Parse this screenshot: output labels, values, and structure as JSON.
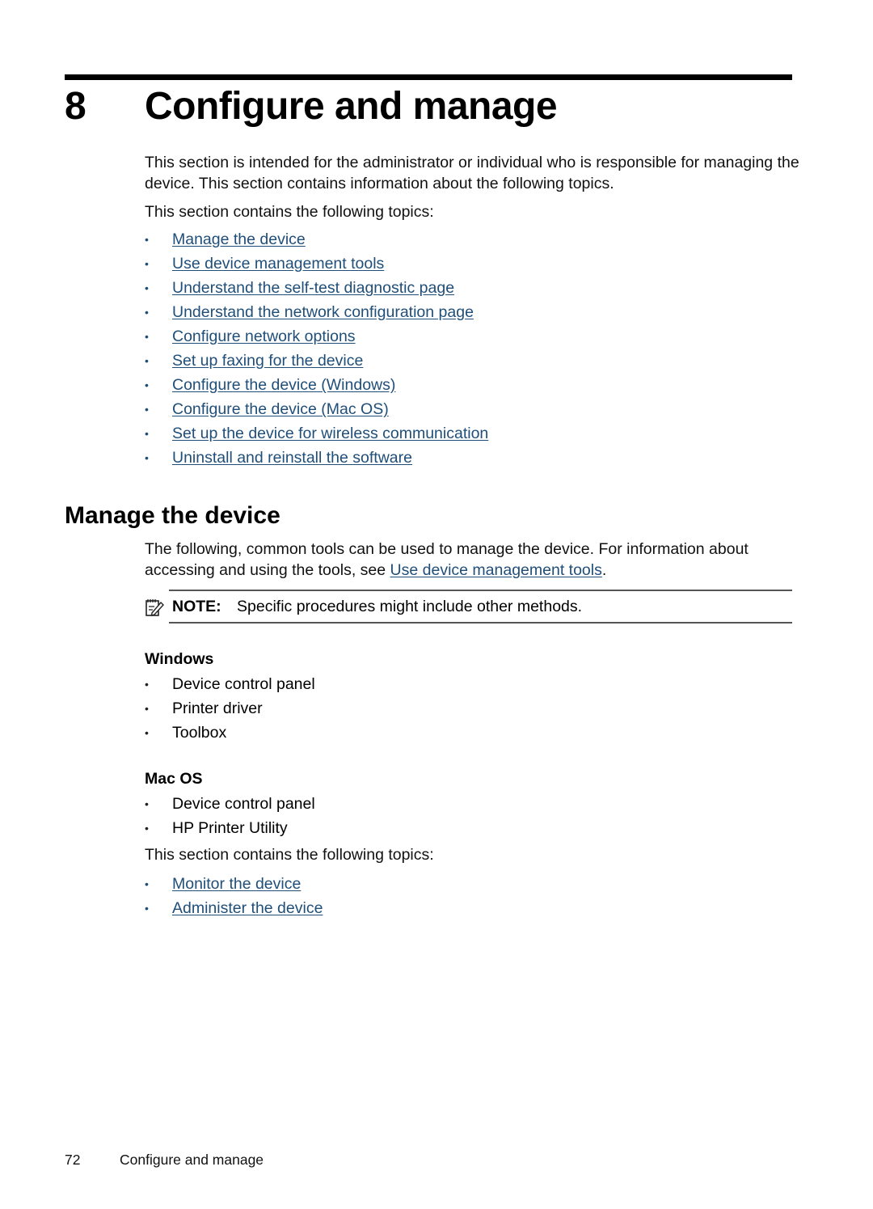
{
  "chapter": {
    "number": "8",
    "title": "Configure and manage"
  },
  "intro": {
    "paragraph": "This section is intended for the administrator or individual who is responsible for managing the device. This section contains information about the following topics.",
    "topics_lead": "This section contains the following topics:",
    "topics": [
      {
        "label": "Manage the device"
      },
      {
        "label": "Use device management tools"
      },
      {
        "label": "Understand the self-test diagnostic page"
      },
      {
        "label": "Understand the network configuration page"
      },
      {
        "label": "Configure network options"
      },
      {
        "label": "Set up faxing for the device"
      },
      {
        "label": "Configure the device (Windows)"
      },
      {
        "label": "Configure the device (Mac OS)"
      },
      {
        "label": "Set up the device for wireless communication"
      },
      {
        "label": "Uninstall and reinstall the software"
      }
    ]
  },
  "manage_section": {
    "heading": "Manage the device",
    "paragraph_before_link": "The following, common tools can be used to manage the device. For information about accessing and using the tools, see ",
    "paragraph_link": "Use device management tools",
    "paragraph_after_link": ".",
    "note": {
      "icon": "note-pencil-icon",
      "label": "NOTE:",
      "text": "Specific procedures might include other methods."
    },
    "windows": {
      "heading": "Windows",
      "items": [
        "Device control panel",
        "Printer driver",
        "Toolbox"
      ]
    },
    "mac": {
      "heading": "Mac OS",
      "items": [
        "Device control panel",
        "HP Printer Utility"
      ]
    },
    "topics_lead": "This section contains the following topics:",
    "topics": [
      {
        "label": "Monitor the device"
      },
      {
        "label": "Administer the device"
      }
    ]
  },
  "footer": {
    "page_number": "72",
    "chapter_title": "Configure and manage"
  },
  "colors": {
    "link": "#1f4e79",
    "text": "#000000"
  }
}
